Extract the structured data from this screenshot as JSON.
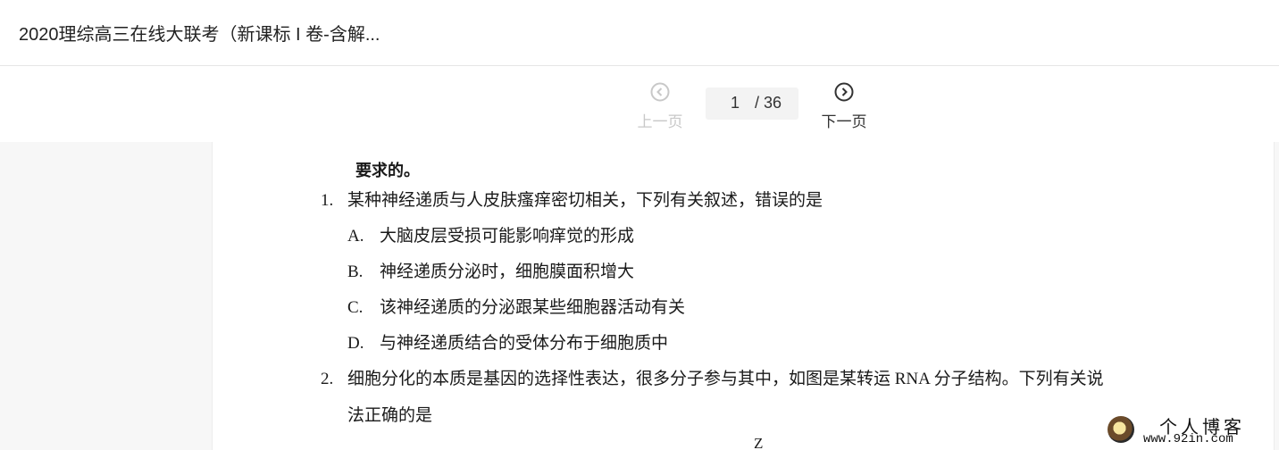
{
  "header": {
    "title": "2020理综高三在线大联考（新课标 I 卷-含解..."
  },
  "pager": {
    "prev_label": "上一页",
    "next_label": "下一页",
    "current_page": "1",
    "total": "/ 36",
    "prev_icon": "chevron-left-circle-icon",
    "next_icon": "chevron-right-circle-icon"
  },
  "document": {
    "cut_top_text": "要求的。",
    "q1": {
      "number": "1.",
      "text": "某种神经递质与人皮肤瘙痒密切相关，下列有关叙述，错误的是",
      "options": [
        {
          "key": "A.",
          "text": "大脑皮层受损可能影响痒觉的形成"
        },
        {
          "key": "B.",
          "text": "神经递质分泌时，细胞膜面积增大"
        },
        {
          "key": "C.",
          "text": "该神经递质的分泌跟某些细胞器活动有关"
        },
        {
          "key": "D.",
          "text": "与神经递质结合的受体分布于细胞质中"
        }
      ]
    },
    "q2": {
      "number": "2.",
      "text_line1": "细胞分化的本质是基因的选择性表达，很多分子参与其中，如图是某转运 RNA 分子结构。下列有关说",
      "text_line2": "法正确的是"
    },
    "figure_fragment": "Z"
  },
  "watermark": {
    "line1": "个人博客",
    "line2": "www.92in.com"
  },
  "colors": {
    "disabled": "#c8c8c8",
    "enabled": "#333333",
    "page_bg": "#f7f7f7"
  }
}
